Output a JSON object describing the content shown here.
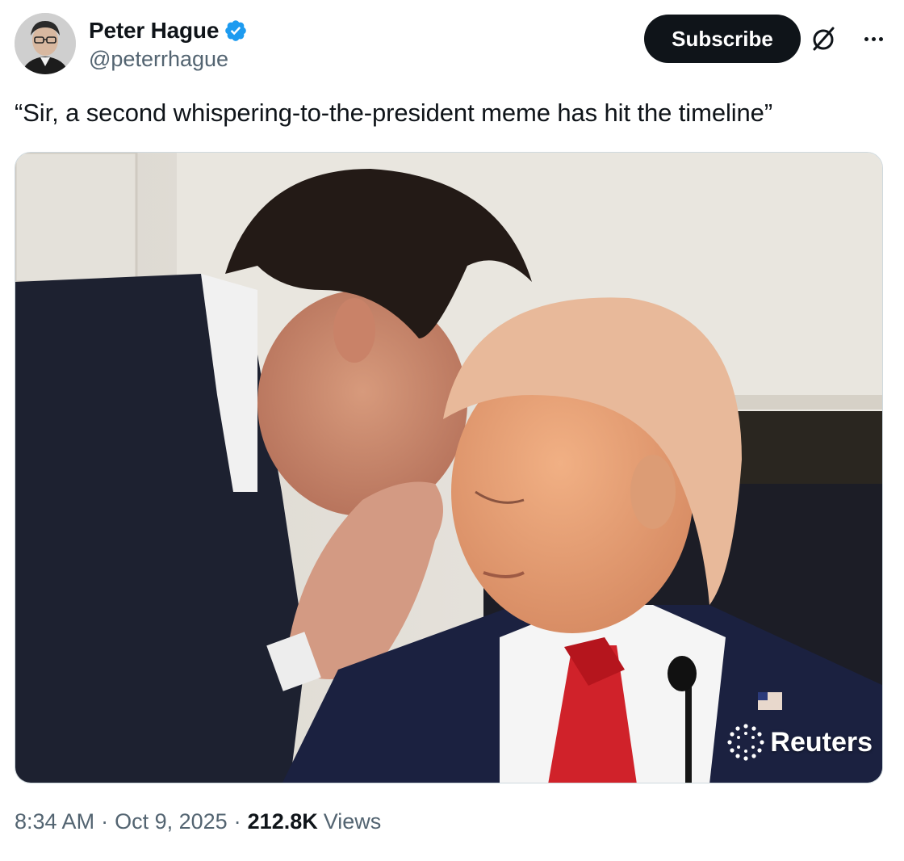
{
  "author": {
    "display_name": "Peter Hague",
    "handle": "@peterrhague",
    "verified": true,
    "avatar_icon": "profile-photo"
  },
  "actions": {
    "subscribe_label": "Subscribe",
    "grok_icon": "grok-slash-circle-icon",
    "more_icon": "ellipsis-icon"
  },
  "tweet": {
    "text": "“Sir, a second whispering-to-the-president meme has hit the timeline”",
    "media": {
      "watermark": "Reuters"
    }
  },
  "meta": {
    "time": "8:34 AM",
    "separator": "·",
    "date": "Oct 9, 2025",
    "views_count": "212.8K",
    "views_label": "Views"
  },
  "colors": {
    "text_primary": "#0f1419",
    "text_secondary": "#536471",
    "verified_blue": "#1d9bf0",
    "subscribe_bg": "#0f1419"
  }
}
